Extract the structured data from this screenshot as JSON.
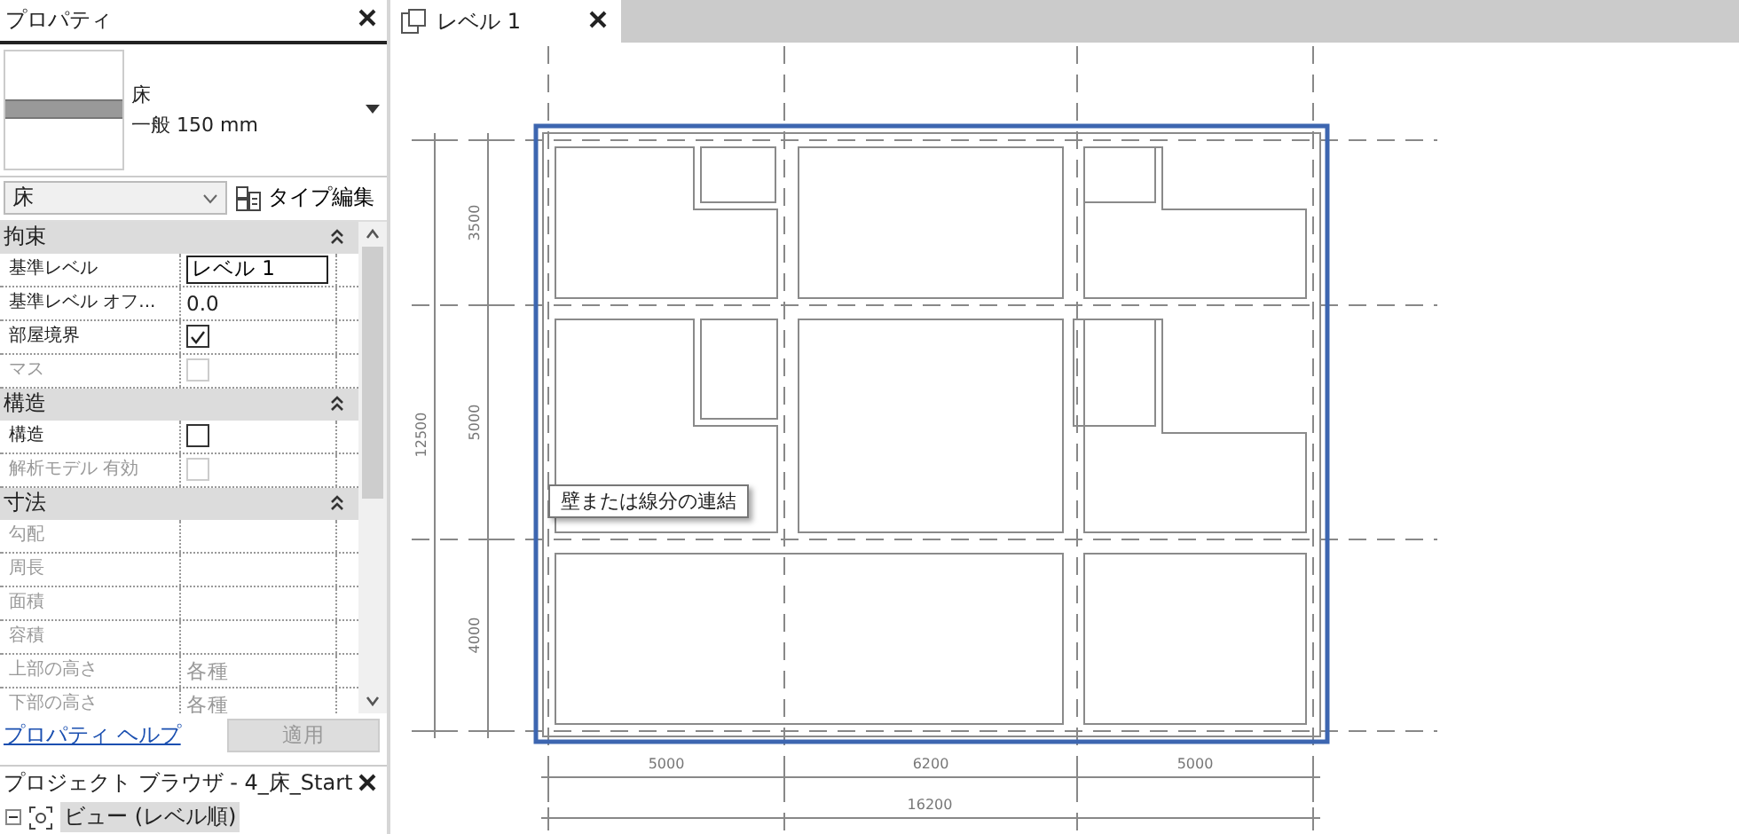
{
  "properties_panel": {
    "title": "プロパティ",
    "type_selector": {
      "family": "床",
      "type": "一般 150 mm"
    },
    "category_filter": {
      "value": "床"
    },
    "edit_type_button": "タイプ編集",
    "groups": [
      {
        "name": "拘束",
        "expanded": true,
        "rows": [
          {
            "label": "基準レベル",
            "kind": "input",
            "value": "レベル 1",
            "disabled": false
          },
          {
            "label": "基準レベル オフ...",
            "kind": "text",
            "value": "0.0",
            "disabled": false
          },
          {
            "label": "部屋境界",
            "kind": "checkbox",
            "checked": true,
            "disabled": false
          },
          {
            "label": "マス",
            "kind": "checkbox",
            "checked": false,
            "disabled": true
          }
        ]
      },
      {
        "name": "構造",
        "expanded": true,
        "rows": [
          {
            "label": "構造",
            "kind": "checkbox",
            "checked": false,
            "disabled": false
          },
          {
            "label": "解析モデル 有効",
            "kind": "checkbox",
            "checked": false,
            "disabled": true
          }
        ]
      },
      {
        "name": "寸法",
        "expanded": true,
        "rows": [
          {
            "label": "勾配",
            "kind": "text",
            "disabled": true
          },
          {
            "label": "周長",
            "kind": "text",
            "disabled": true
          },
          {
            "label": "面積",
            "kind": "text",
            "disabled": true
          },
          {
            "label": "容積",
            "kind": "text",
            "disabled": true
          },
          {
            "label": "上部の高さ",
            "kind": "text",
            "value": "各種",
            "disabled": true
          },
          {
            "label": "下部の高さ",
            "kind": "text",
            "value": "各種",
            "disabled": true
          }
        ]
      }
    ],
    "help_link": "プロパティ ヘルプ",
    "apply_button": {
      "label": "適用",
      "disabled": true
    }
  },
  "project_browser": {
    "title": "プロジェクト ブラウザ - 4_床_Start",
    "tree": [
      {
        "label": "ビュー (レベル順)",
        "expanded": true,
        "selected": true
      }
    ]
  },
  "view_tabs": [
    {
      "label": "レベル 1",
      "selected": true
    }
  ],
  "plan": {
    "vertical_dimensions": [
      "3500",
      "5000",
      "4000"
    ],
    "vertical_total": "12500",
    "horizontal_dimensions": [
      "5000",
      "6200",
      "5000"
    ],
    "horizontal_total": "16200",
    "tooltip": "壁または線分の連結"
  }
}
